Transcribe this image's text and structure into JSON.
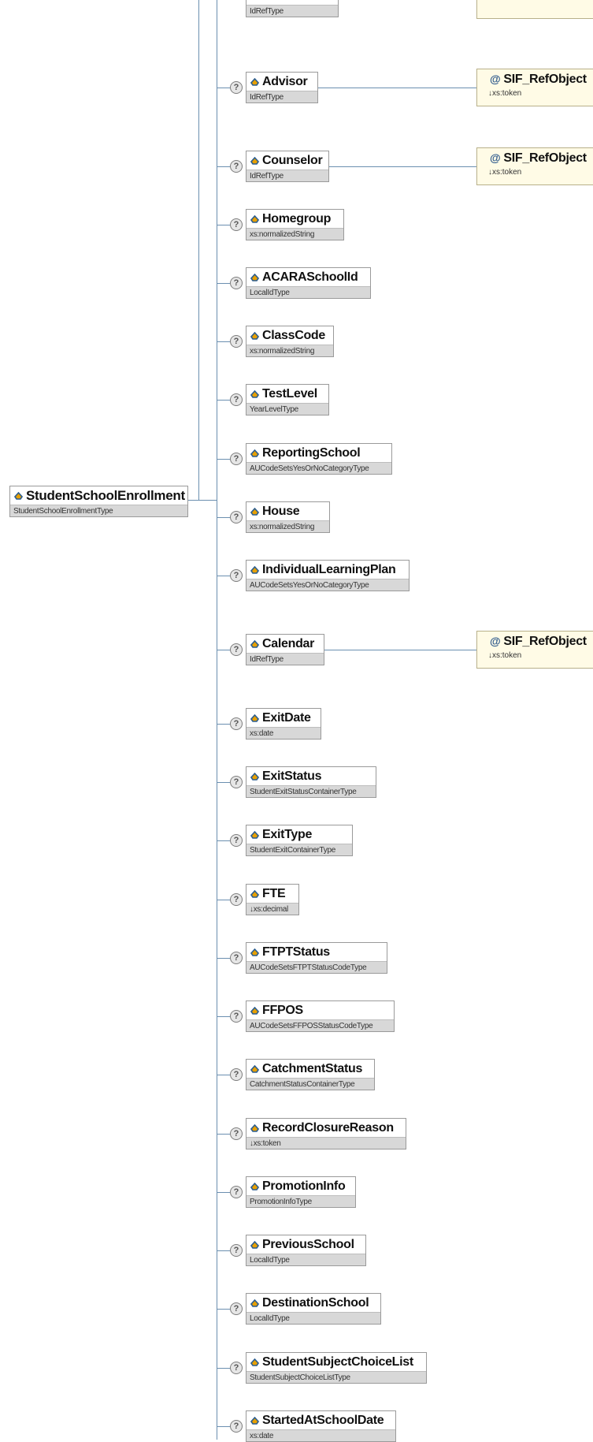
{
  "root": {
    "name": "StudentSchoolEnrollment",
    "type": "StudentSchoolEnrollmentType"
  },
  "partial": {
    "top": {
      "type": "IdRefType"
    },
    "ref_type": "↓xs:token"
  },
  "elements": [
    {
      "name": "Advisor",
      "type": "IdRefType",
      "ref": {
        "name": "SIF_RefObject",
        "type": "↓xs:token"
      }
    },
    {
      "name": "Counselor",
      "type": "IdRefType",
      "ref": {
        "name": "SIF_RefObject",
        "type": "↓xs:token"
      }
    },
    {
      "name": "Homegroup",
      "type": "xs:normalizedString"
    },
    {
      "name": "ACARASchoolId",
      "type": "LocalIdType"
    },
    {
      "name": "ClassCode",
      "type": "xs:normalizedString"
    },
    {
      "name": "TestLevel",
      "type": "YearLevelType"
    },
    {
      "name": "ReportingSchool",
      "type": "AUCodeSetsYesOrNoCategoryType"
    },
    {
      "name": "House",
      "type": "xs:normalizedString"
    },
    {
      "name": "IndividualLearningPlan",
      "type": "AUCodeSetsYesOrNoCategoryType"
    },
    {
      "name": "Calendar",
      "type": "IdRefType",
      "ref": {
        "name": "SIF_RefObject",
        "type": "↓xs:token"
      }
    },
    {
      "name": "ExitDate",
      "type": "xs:date"
    },
    {
      "name": "ExitStatus",
      "type": "StudentExitStatusContainerType"
    },
    {
      "name": "ExitType",
      "type": "StudentExitContainerType"
    },
    {
      "name": "FTE",
      "type": "↓xs:decimal"
    },
    {
      "name": "FTPTStatus",
      "type": "AUCodeSetsFTPTStatusCodeType"
    },
    {
      "name": "FFPOS",
      "type": "AUCodeSetsFFPOSStatusCodeType"
    },
    {
      "name": "CatchmentStatus",
      "type": "CatchmentStatusContainerType"
    },
    {
      "name": "RecordClosureReason",
      "type": "↓xs:token"
    },
    {
      "name": "PromotionInfo",
      "type": "PromotionInfoType"
    },
    {
      "name": "PreviousSchool",
      "type": "LocalIdType"
    },
    {
      "name": "DestinationSchool",
      "type": "LocalIdType"
    },
    {
      "name": "StudentSubjectChoiceList",
      "type": "StudentSubjectChoiceListType"
    },
    {
      "name": "StartedAtSchoolDate",
      "type": "xs:date"
    }
  ],
  "icons": {
    "optional": "?",
    "attribute": "@",
    "element": "element-icon"
  },
  "colors": {
    "connector": "#6b8fb0",
    "type_bar": "#d8d8d8",
    "ref_fill": "#fffbe6"
  }
}
